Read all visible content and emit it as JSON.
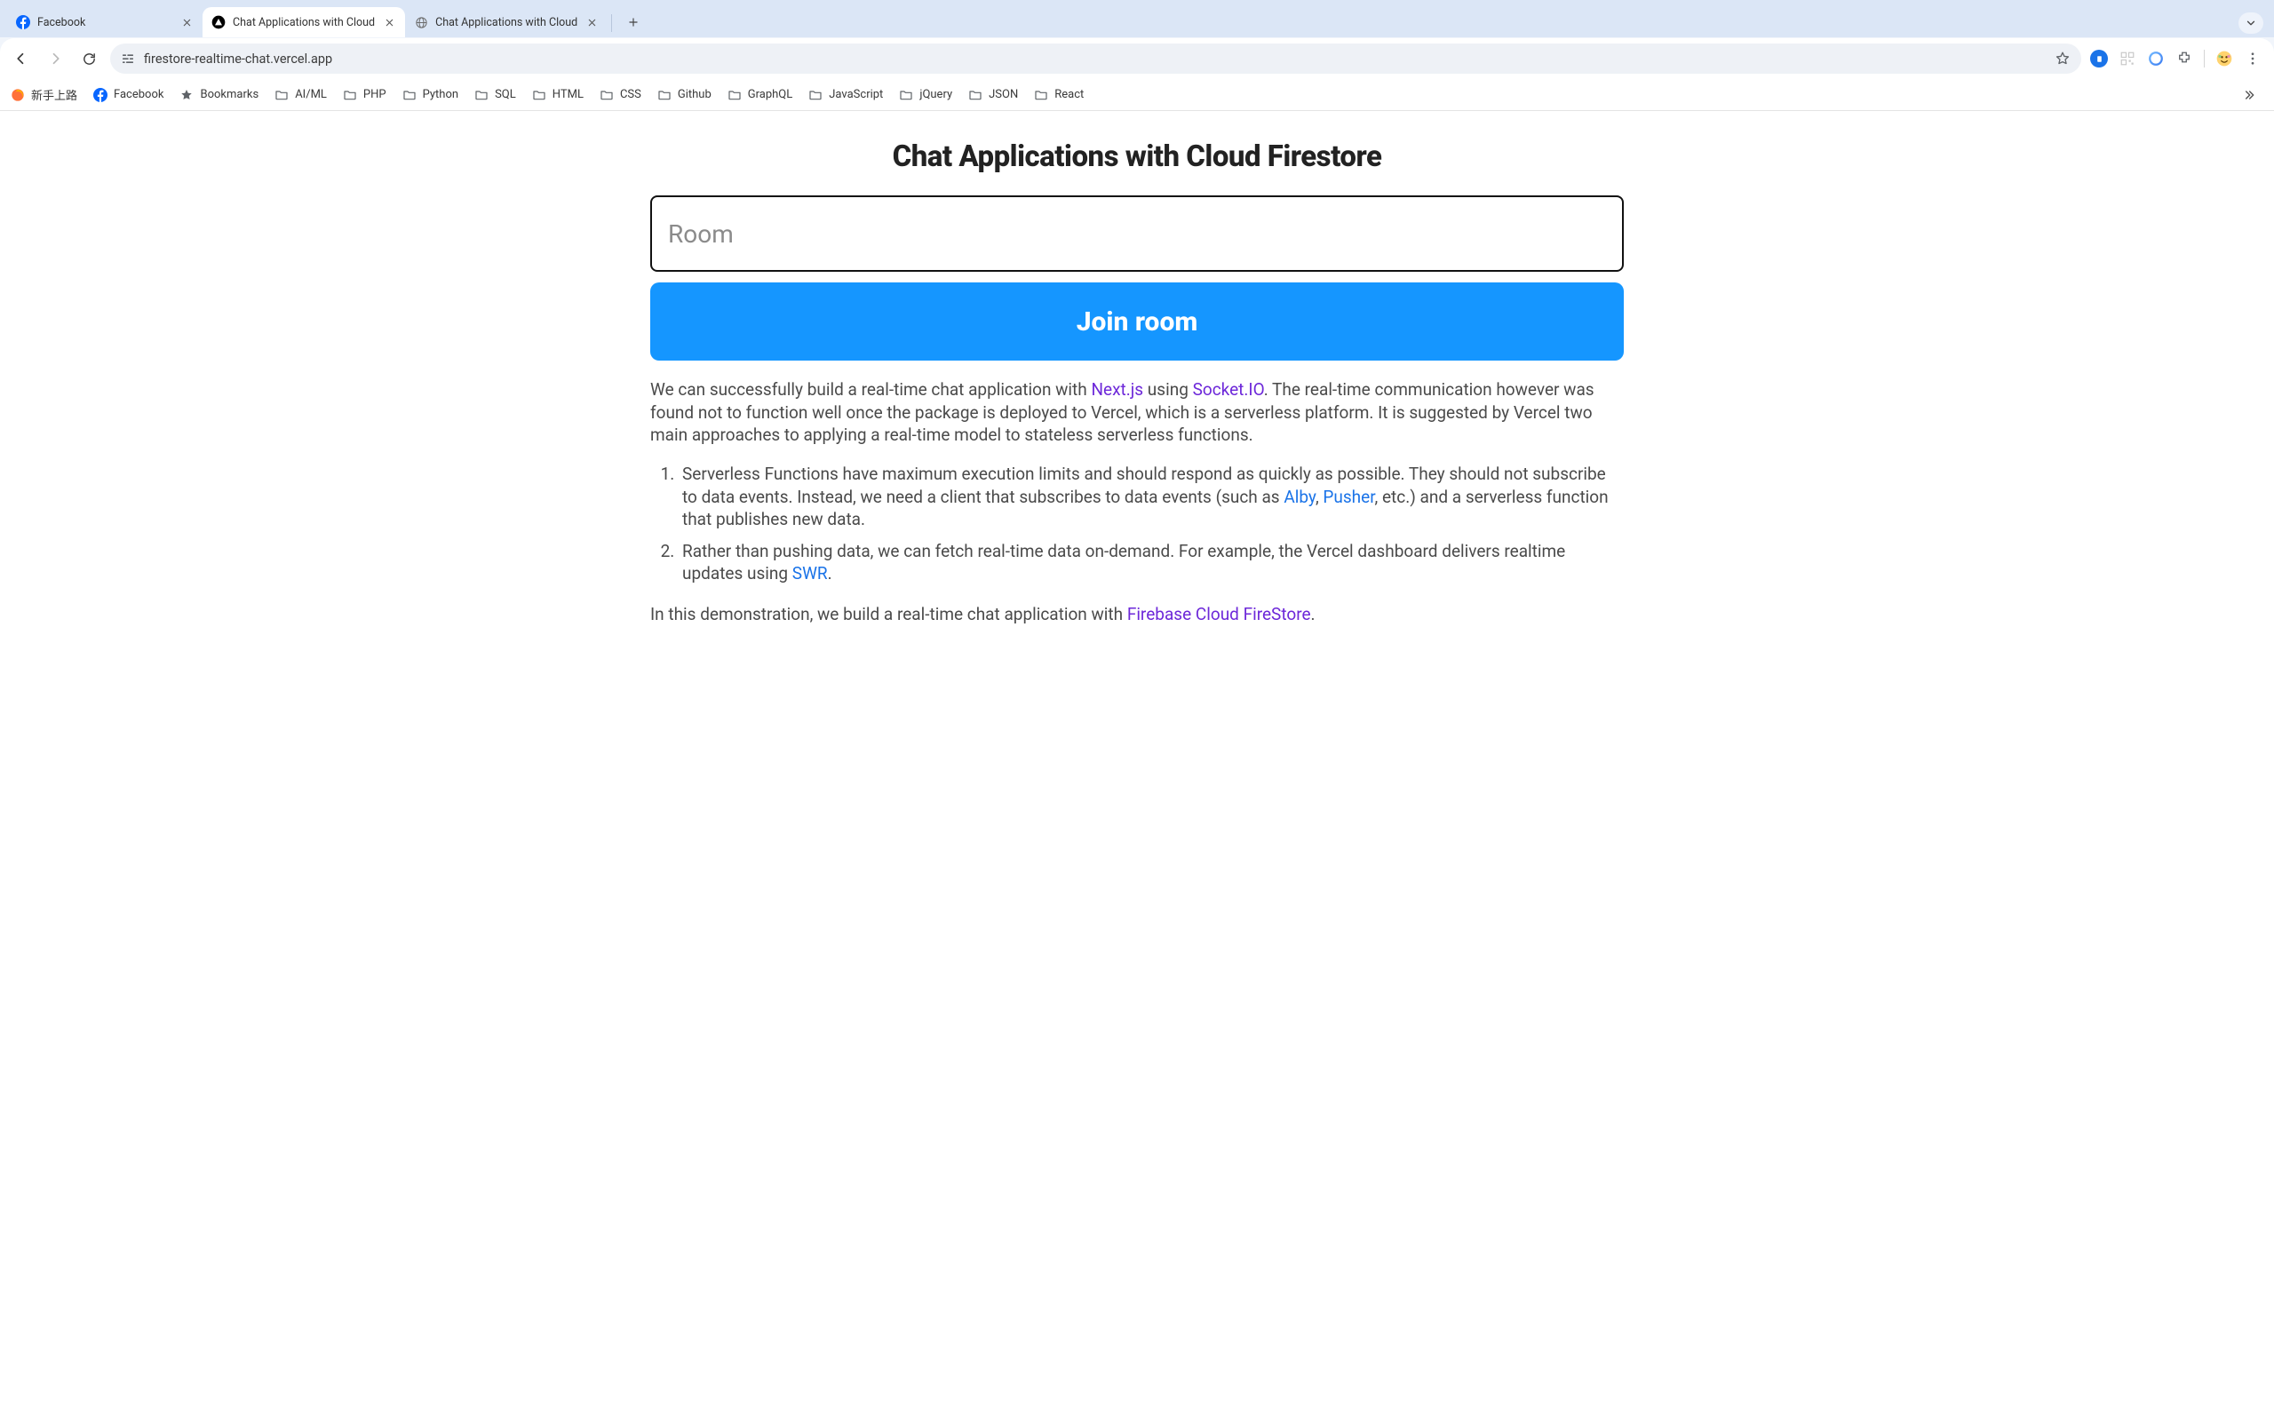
{
  "browser": {
    "tabs": [
      {
        "title": "Facebook",
        "active": false,
        "icon": "facebook"
      },
      {
        "title": "Chat Applications with Cloud",
        "active": true,
        "icon": "vercel"
      },
      {
        "title": "Chat Applications with Cloud",
        "active": false,
        "icon": "globe"
      }
    ],
    "omnibox_url": "firestore-realtime-chat.vercel.app",
    "bookmarks": [
      {
        "label": "新手上路",
        "icon": "firefox"
      },
      {
        "label": "Facebook",
        "icon": "facebook"
      },
      {
        "label": "Bookmarks",
        "icon": "star"
      },
      {
        "label": "AI/ML",
        "icon": "folder"
      },
      {
        "label": "PHP",
        "icon": "folder"
      },
      {
        "label": "Python",
        "icon": "folder"
      },
      {
        "label": "SQL",
        "icon": "folder"
      },
      {
        "label": "HTML",
        "icon": "folder"
      },
      {
        "label": "CSS",
        "icon": "folder"
      },
      {
        "label": "Github",
        "icon": "folder"
      },
      {
        "label": "GraphQL",
        "icon": "folder"
      },
      {
        "label": "JavaScript",
        "icon": "folder"
      },
      {
        "label": "jQuery",
        "icon": "folder"
      },
      {
        "label": "JSON",
        "icon": "folder"
      },
      {
        "label": "React",
        "icon": "folder"
      }
    ]
  },
  "page": {
    "title": "Chat Applications with Cloud Firestore",
    "room_placeholder": "Room",
    "join_label": "Join room",
    "paragraph1": {
      "pre": "We can successfully build a real-time chat application with ",
      "link1": "Next.js",
      "mid": " using ",
      "link2": "Socket.IO",
      "post": ". The real-time communication however was found not to function well once the package is deployed to Vercel, which is a serverless platform. It is suggested by Vercel two main approaches to applying a real-time model to stateless serverless functions."
    },
    "bullet1": {
      "pre": "Serverless Functions have maximum execution limits and should respond as quickly as possible. They should not subscribe to data events. Instead, we need a client that subscribes to data events (such as ",
      "link1": "Alby",
      "sep": ", ",
      "link2": "Pusher",
      "post": ", etc.) and a serverless function that publishes new data."
    },
    "bullet2": {
      "pre": "Rather than pushing data, we can fetch real-time data on-demand. For example, the Vercel dashboard delivers realtime updates using ",
      "link1": "SWR",
      "post": "."
    },
    "paragraph2": {
      "pre": "In this demonstration, we build a real-time chat application with ",
      "link1": "Firebase Cloud FireStore",
      "post": "."
    }
  }
}
